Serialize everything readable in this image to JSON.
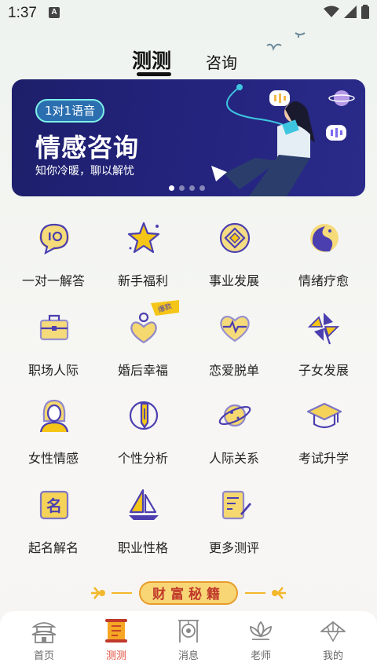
{
  "status": {
    "time": "1:37",
    "notif_icon": "A"
  },
  "tabs": {
    "active": "测测",
    "inactive": "咨询"
  },
  "banner": {
    "badge": "1对1语音",
    "title": "情感咨询",
    "subtitle": "知你冷暖，聊以解忧",
    "dots": 4,
    "active_dot": 0
  },
  "grid": [
    {
      "label": "一对一解答",
      "icon": "chat-bubble-icon"
    },
    {
      "label": "新手福利",
      "icon": "star-icon"
    },
    {
      "label": "事业发展",
      "icon": "coin-icon"
    },
    {
      "label": "情绪疗愈",
      "icon": "yin-yang-fish-icon"
    },
    {
      "label": "职场人际",
      "icon": "briefcase-icon"
    },
    {
      "label": "婚后幸福",
      "icon": "heart-person-icon",
      "badge": "爆款"
    },
    {
      "label": "恋爱脱单",
      "icon": "heartbeat-icon"
    },
    {
      "label": "子女发展",
      "icon": "pinwheel-icon"
    },
    {
      "label": "女性情感",
      "icon": "woman-icon"
    },
    {
      "label": "个性分析",
      "icon": "pen-circle-icon"
    },
    {
      "label": "人际关系",
      "icon": "planet-icon"
    },
    {
      "label": "考试升学",
      "icon": "graduation-cap-icon"
    },
    {
      "label": "起名解名",
      "icon": "name-seal-icon"
    },
    {
      "label": "职业性格",
      "icon": "sailboat-icon"
    },
    {
      "label": "更多测评",
      "icon": "scroll-pen-icon"
    }
  ],
  "wealth_banner": "财富秘籍",
  "nav": [
    {
      "label": "首页",
      "icon": "temple-icon",
      "active": false
    },
    {
      "label": "测测",
      "icon": "scroll-icon",
      "active": true
    },
    {
      "label": "消息",
      "icon": "gong-icon",
      "active": false
    },
    {
      "label": "老师",
      "icon": "lotus-icon",
      "active": false
    },
    {
      "label": "我的",
      "icon": "straw-hat-icon",
      "active": false
    }
  ],
  "colors": {
    "accent_yellow": "#f5c518",
    "icon_purple": "#4b3fb0",
    "nav_active": "#e04b3b",
    "banner_bg": "#23237c"
  }
}
